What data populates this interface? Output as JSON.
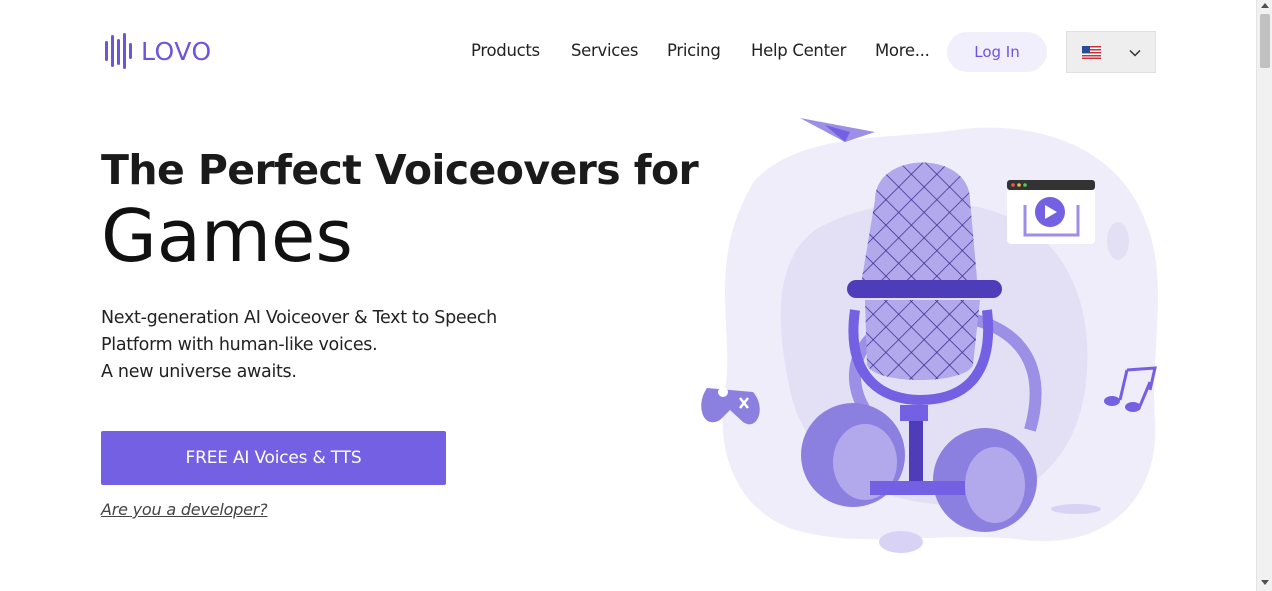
{
  "header": {
    "logo_text": "LOVO",
    "nav": [
      {
        "label": "Products"
      },
      {
        "label": "Services"
      },
      {
        "label": "Pricing"
      },
      {
        "label": "Help Center"
      },
      {
        "label": "More..."
      }
    ],
    "login_label": "Log In",
    "language": {
      "flag_icon": "us-flag-icon",
      "chevron_icon": "chevron-down-icon"
    }
  },
  "hero": {
    "title_line1": "The Perfect Voiceovers for",
    "title_line2": "Games",
    "description": [
      "Next-generation AI Voiceover & Text to Speech",
      "Platform with human-like voices.",
      "A new universe awaits."
    ],
    "cta_label": "FREE AI Voices & TTS",
    "developer_link": "Are you a developer?"
  },
  "colors": {
    "brand": "#6a55dd",
    "cta": "#7360e2",
    "login_bg": "#f1effc",
    "illustration_light": "#efedfa",
    "illustration_mid": "#9b8fe6",
    "illustration_dark": "#5b47c9"
  }
}
